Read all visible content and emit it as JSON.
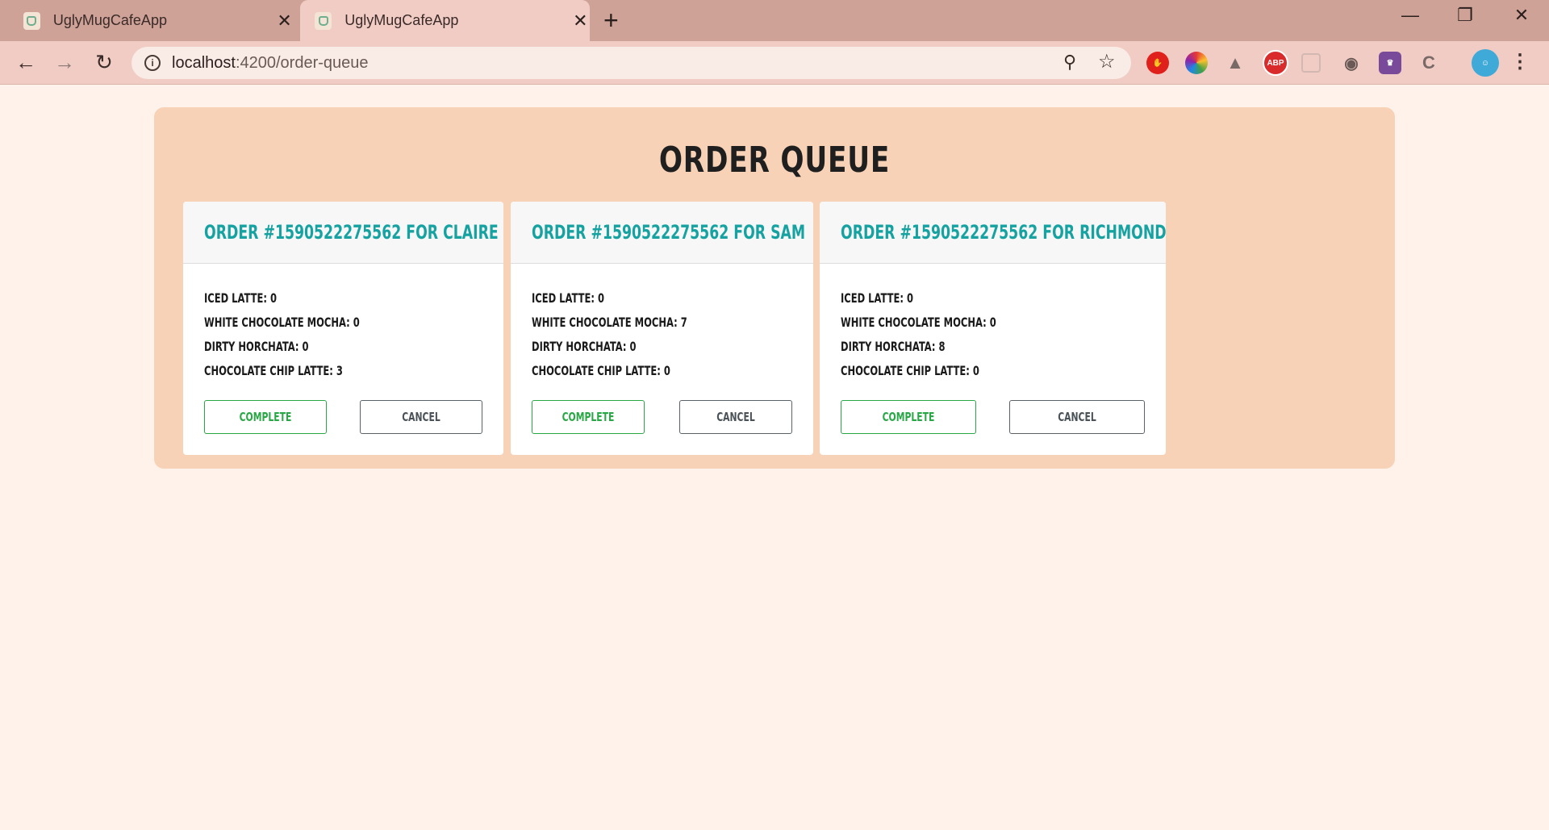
{
  "browser": {
    "tabs": [
      {
        "title": "UglyMugCafeApp",
        "active": false
      },
      {
        "title": "UglyMugCafeApp",
        "active": true
      }
    ],
    "new_tab_icon": "+",
    "url_host": "localhost",
    "url_rest": ":4200/order-queue",
    "window_controls": {
      "minimize": "—",
      "restore": "❐",
      "close": "✕"
    }
  },
  "page": {
    "title": "ORDER QUEUE",
    "item_labels": {
      "iced_latte": "ICED LATTE: ",
      "white_mocha": "WHITE CHOCOLATE MOCHA: ",
      "horchata": "DIRTY HORCHATA: ",
      "choc_chip": "CHOCOLATE CHIP LATTE: "
    },
    "orders": [
      {
        "heading": "ORDER #1590522275562 FOR CLAIRE",
        "items": [
          "ICED LATTE: 0",
          "WHITE CHOCOLATE MOCHA: 0",
          "DIRTY HORCHATA: 0",
          "CHOCOLATE CHIP LATTE: 3"
        ],
        "complete_label": "COMPLETE",
        "cancel_label": "CANCEL"
      },
      {
        "heading": "ORDER #1590522275562 FOR SAM",
        "items": [
          "ICED LATTE: 0",
          "WHITE CHOCOLATE MOCHA: 7",
          "DIRTY HORCHATA: 0",
          "CHOCOLATE CHIP LATTE: 0"
        ],
        "complete_label": "COMPLETE",
        "cancel_label": "CANCEL"
      },
      {
        "heading": "ORDER #1590522275562 FOR RICHMOND",
        "items": [
          "ICED LATTE: 0",
          "WHITE CHOCOLATE MOCHA: 0",
          "DIRTY HORCHATA: 8",
          "CHOCOLATE CHIP LATTE: 0"
        ],
        "complete_label": "COMPLETE",
        "cancel_label": "CANCEL"
      }
    ]
  },
  "colors": {
    "page_bg": "#fef2ea",
    "panel_bg": "#f7d2b6",
    "heading_teal": "#17a2a2",
    "complete_green": "#28a745",
    "cancel_gray": "#5a6268"
  }
}
